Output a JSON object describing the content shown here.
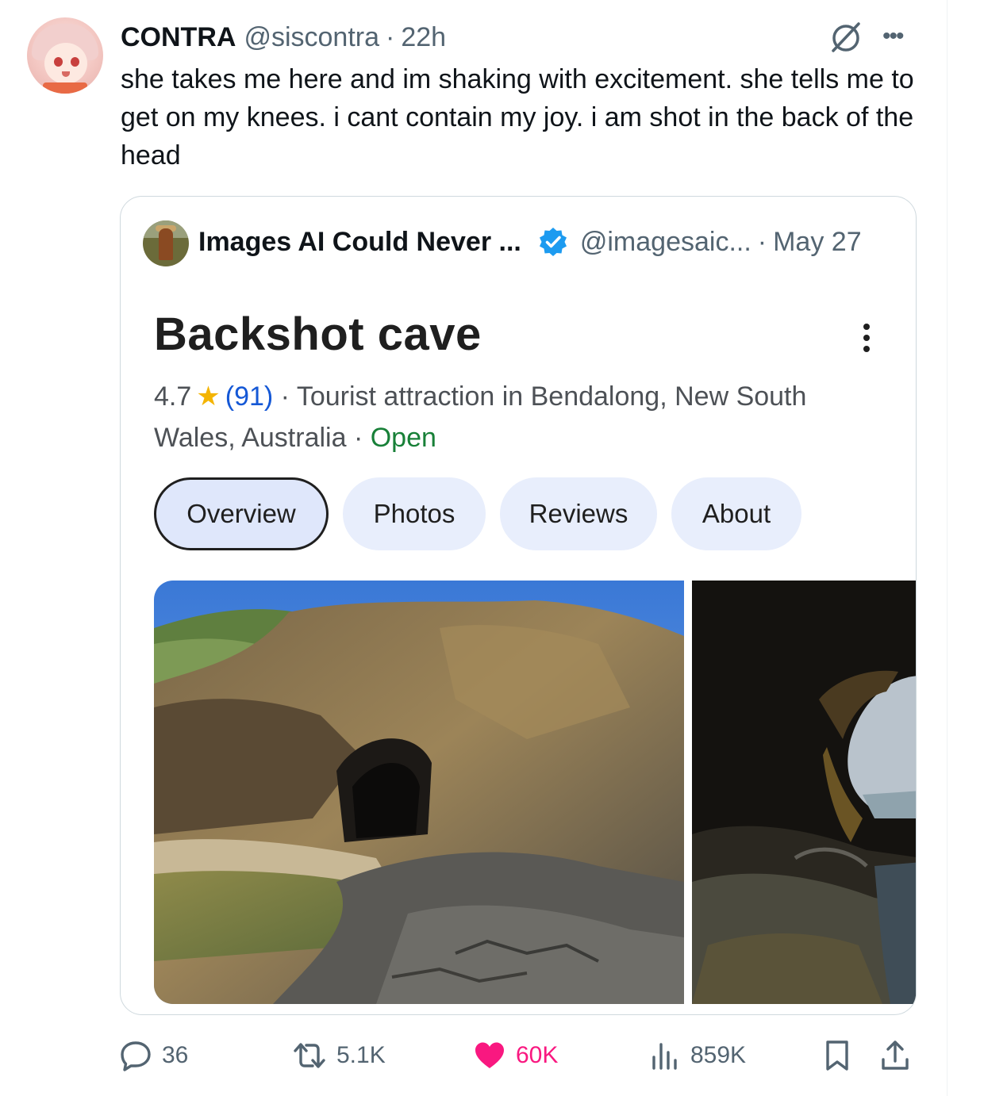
{
  "tweet": {
    "author": {
      "display_name": "CONTRA",
      "handle": "@siscontra",
      "separator": "·",
      "time": "22h"
    },
    "text": "she takes me here and im shaking with excitement. she tells me to get on my knees. i cant contain my joy. i am shot in the back of the head",
    "icons": {
      "grok": "grok-icon",
      "more": "more-icon"
    }
  },
  "quote": {
    "author": {
      "display_name": "Images AI Could Never ...",
      "handle": "@imagesaic...",
      "separator": "·",
      "date": "May 27",
      "verified": true
    },
    "place": {
      "title": "Backshot cave",
      "rating": "4.7",
      "star": "★",
      "review_count": "(91)",
      "description": " · Tourist attraction in Bendalong, New South Wales, Australia · ",
      "status": "Open",
      "status_color": "#188038"
    },
    "tabs": [
      {
        "label": "Overview",
        "active": true
      },
      {
        "label": "Photos",
        "active": false
      },
      {
        "label": "Reviews",
        "active": false
      },
      {
        "label": "About",
        "active": false
      }
    ]
  },
  "actions": {
    "replies": "36",
    "reposts": "5.1K",
    "likes": "60K",
    "views": "859K",
    "like_color": "#f91880"
  }
}
